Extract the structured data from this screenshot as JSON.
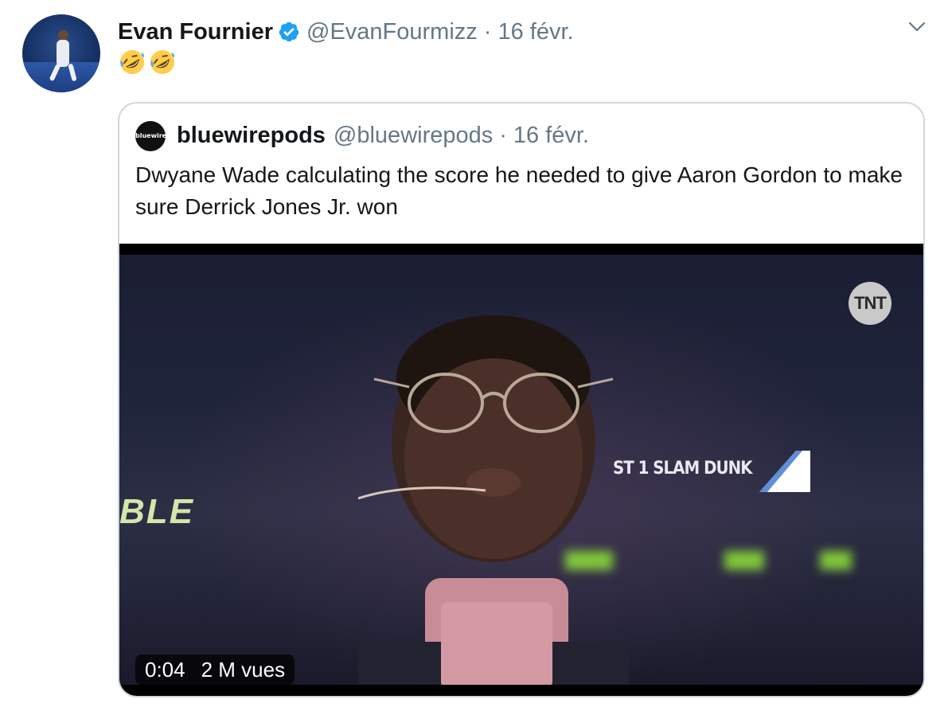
{
  "tweet": {
    "author": {
      "display_name": "Evan Fournier",
      "handle": "@EvanFourmizz",
      "verified": true,
      "avatar_icon": "basketball-player-avatar"
    },
    "date": "16 févr.",
    "separator": "·",
    "body_emojis": [
      "rolling-on-floor-laughing-emoji",
      "rolling-on-floor-laughing-emoji"
    ],
    "menu_icon": "chevron-down-icon",
    "quoted": {
      "author": {
        "display_name": "bluewirepods",
        "handle": "@bluewirepods",
        "avatar_label": "bluewire"
      },
      "date": "16 févr.",
      "separator": "·",
      "text": "Dwyane Wade calculating the score he needed to give Aaron Gordon to make sure Derrick Jones Jr. won",
      "video": {
        "duration": "0:04",
        "views": "2 M vues",
        "watermark": "TNT",
        "arena_banner": "ST 1 SLAM DUNK",
        "arena_banner_left": "BLE"
      }
    }
  },
  "colors": {
    "text_primary": "#14171a",
    "text_secondary": "#657786",
    "verified_blue": "#1da1f2",
    "border": "#cfd9de"
  }
}
